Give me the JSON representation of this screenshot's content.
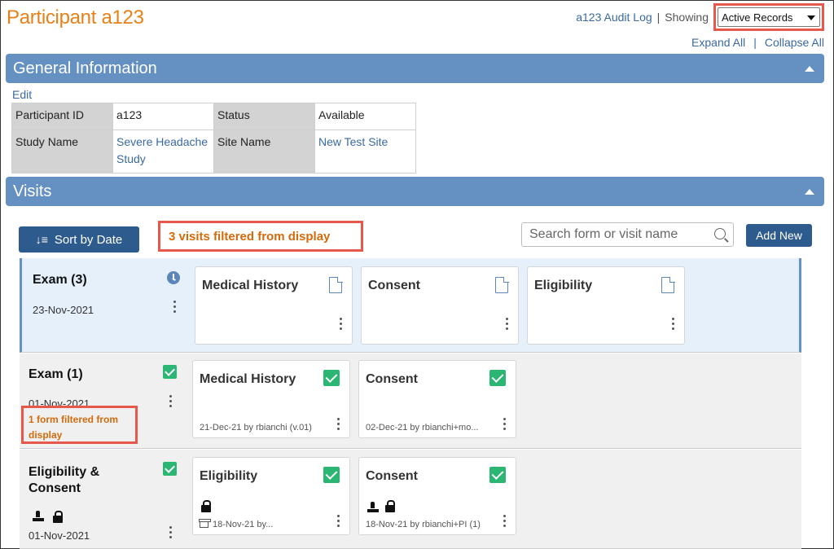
{
  "header": {
    "title": "Participant a123",
    "audit_log": "a123 Audit Log",
    "separator": "|",
    "showing_label": "Showing",
    "showing_value": "Active Records",
    "expand_all": "Expand All",
    "collapse_all": "Collapse All"
  },
  "general": {
    "title": "General Information",
    "edit": "Edit",
    "participant_id_label": "Participant ID",
    "participant_id": "a123",
    "status_label": "Status",
    "status": "Available",
    "study_name_label": "Study Name",
    "study_name": "Severe Headache Study",
    "site_name_label": "Site Name",
    "site_name": "New Test Site"
  },
  "visits": {
    "title": "Visits",
    "sort_label": "Sort by Date",
    "filter_notice": "3 visits filtered from display",
    "search_placeholder": "Search form or visit name",
    "add_new": "Add New",
    "items": [
      {
        "name": "Exam (3)",
        "date": "23-Nov-2021",
        "forms": [
          {
            "title": "Medical History",
            "meta": ""
          },
          {
            "title": "Consent",
            "meta": ""
          },
          {
            "title": "Eligibility",
            "meta": ""
          }
        ]
      },
      {
        "name": "Exam (1)",
        "date": "01-Nov-2021",
        "form_filter_notice": "1 form filtered from display",
        "forms": [
          {
            "title": "Medical History",
            "meta": "21-Dec-21 by rbianchi (v.01)"
          },
          {
            "title": "Consent",
            "meta": "02-Dec-21 by rbianchi+mo..."
          }
        ]
      },
      {
        "name": "Eligibility & Consent",
        "date": "01-Nov-2021",
        "forms": [
          {
            "title": "Eligibility",
            "meta": "18-Nov-21 by..."
          },
          {
            "title": "Consent",
            "meta": "18-Nov-21 by rbianchi+PI (1)"
          }
        ]
      }
    ]
  },
  "colors": {
    "brand_orange": "#e8801a",
    "panel_blue": "#6591c2",
    "button_blue": "#2e5b8e",
    "highlight_red": "#e8574c",
    "complete_green": "#2bb673"
  }
}
